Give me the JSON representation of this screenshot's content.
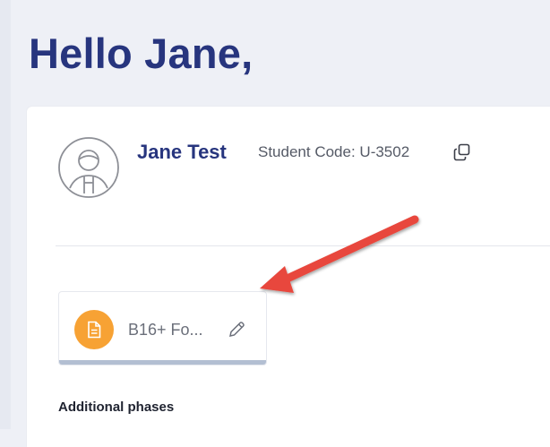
{
  "greeting": "Hello Jane,",
  "profile": {
    "name": "Jane Test",
    "student_code_label": "Student Code: U-3502",
    "avatar_icon": "user-avatar-icon",
    "copy_icon": "copy-icon"
  },
  "phase_card": {
    "title": "B16+ Fo...",
    "badge_icon": "document-icon",
    "badge_color": "#f7a234",
    "edit_icon": "pencil-icon"
  },
  "additional_phases_heading": "Additional phases",
  "annotation": {
    "arrow_color": "#e8473c"
  },
  "colors": {
    "brand": "#27357e",
    "background": "#eef0f6"
  }
}
